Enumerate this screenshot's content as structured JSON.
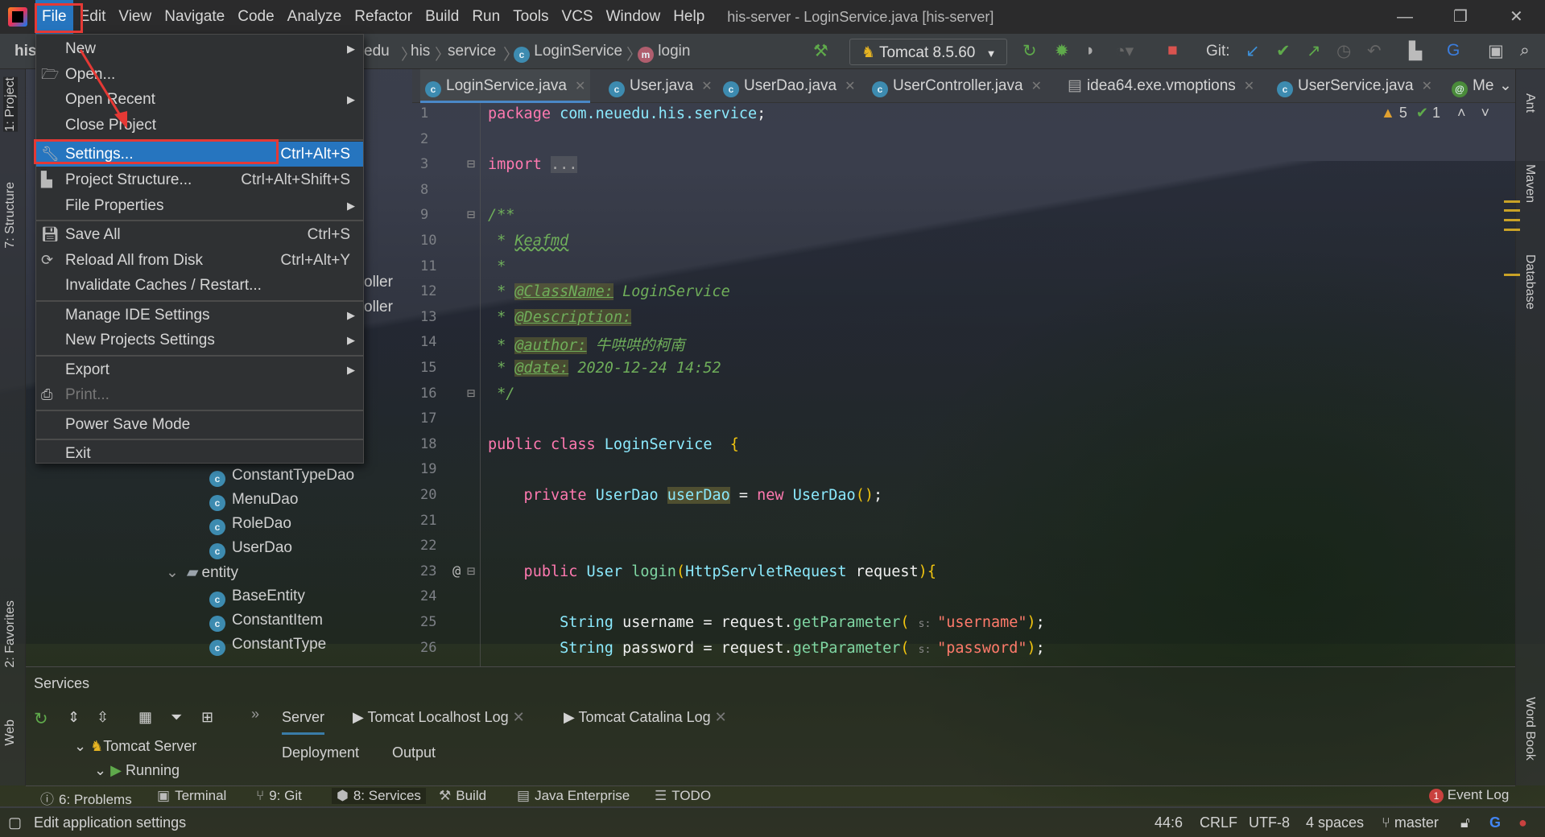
{
  "window": {
    "title": "his-server - LoginService.java [his-server]",
    "minimize": "—",
    "restore": "❐",
    "close": "✕"
  },
  "menubar": [
    "File",
    "Edit",
    "View",
    "Navigate",
    "Code",
    "Analyze",
    "Refactor",
    "Build",
    "Run",
    "Tools",
    "VCS",
    "Window",
    "Help"
  ],
  "breadcrumb": {
    "project": "his",
    "items": [
      "edu",
      "his",
      "service"
    ],
    "class": "LoginService",
    "method": "login"
  },
  "toolbar": {
    "run_config": "Tomcat 8.5.60",
    "git_label": "Git:",
    "accent": "#2675bf"
  },
  "tabs": [
    {
      "label": "LoginService.java",
      "icon": "c",
      "selected": true
    },
    {
      "label": "User.java",
      "icon": "c"
    },
    {
      "label": "UserDao.java",
      "icon": "c"
    },
    {
      "label": "UserController.java",
      "icon": "c"
    },
    {
      "label": "idea64.exe.vmoptions",
      "icon": "file"
    },
    {
      "label": "UserService.java",
      "icon": "c"
    },
    {
      "label": "Me",
      "icon": "@"
    }
  ],
  "left_strip": {
    "project": "1: Project",
    "structure": "7: Structure",
    "favorites": "2: Favorites",
    "web": "Web"
  },
  "right_strip": {
    "ant": "Ant",
    "maven": "Maven",
    "database": "Database",
    "wordbook": "Word Book"
  },
  "file_menu": [
    {
      "label": "New",
      "submenu": true
    },
    {
      "label": "Open...",
      "icon": "folder-icon"
    },
    {
      "label": "Open Recent",
      "submenu": true
    },
    {
      "label": "Close Project"
    },
    {
      "label": "Settings...",
      "shortcut": "Ctrl+Alt+S",
      "icon": "wrench-icon",
      "highlighted": true
    },
    {
      "label": "Project Structure...",
      "shortcut": "Ctrl+Alt+Shift+S",
      "icon": "project-structure-icon"
    },
    {
      "label": "File Properties",
      "submenu": true
    },
    {
      "label": "Save All",
      "shortcut": "Ctrl+S",
      "icon": "save-icon"
    },
    {
      "label": "Reload All from Disk",
      "shortcut": "Ctrl+Alt+Y",
      "icon": "reload-icon"
    },
    {
      "label": "Invalidate Caches / Restart..."
    },
    {
      "label": "Manage IDE Settings",
      "submenu": true
    },
    {
      "label": "New Projects Settings",
      "submenu": true
    },
    {
      "label": "Export",
      "submenu": true
    },
    {
      "label": "Print...",
      "icon": "print-icon",
      "disabled": true
    },
    {
      "label": "Power Save Mode"
    },
    {
      "label": "Exit"
    }
  ],
  "project_tree": {
    "partial": [
      "oller",
      "oller"
    ],
    "items": [
      {
        "label": "ConstantTypeDao",
        "type": "class"
      },
      {
        "label": "MenuDao",
        "type": "class"
      },
      {
        "label": "RoleDao",
        "type": "class"
      },
      {
        "label": "UserDao",
        "type": "class"
      },
      {
        "label": "entity",
        "type": "folder"
      },
      {
        "label": "BaseEntity",
        "type": "class"
      },
      {
        "label": "ConstantItem",
        "type": "class"
      },
      {
        "label": "ConstantType",
        "type": "class"
      }
    ]
  },
  "inspections": {
    "warnings": "5",
    "ok": "1"
  },
  "code": [
    {
      "n": "1",
      "t": [
        [
          "k",
          "package "
        ],
        [
          "t",
          "com.neuedu.his.service"
        ],
        [
          "",
          ";"
        ]
      ]
    },
    {
      "n": "2",
      "t": []
    },
    {
      "n": "3",
      "t": [
        [
          "k",
          "import "
        ],
        [
          "fold",
          "..."
        ]
      ]
    },
    {
      "n": "8",
      "t": []
    },
    {
      "n": "9",
      "t": [
        [
          "c",
          "/**"
        ]
      ]
    },
    {
      "n": "10",
      "t": [
        [
          "c",
          " * "
        ],
        [
          "cw",
          "Keafmd"
        ]
      ]
    },
    {
      "n": "11",
      "t": [
        [
          "c",
          " *"
        ]
      ]
    },
    {
      "n": "12",
      "t": [
        [
          "c",
          " * "
        ],
        [
          "ct",
          "@ClassName:"
        ],
        [
          "c",
          " LoginService"
        ]
      ]
    },
    {
      "n": "13",
      "t": [
        [
          "c",
          " * "
        ],
        [
          "ct",
          "@Description:"
        ]
      ]
    },
    {
      "n": "14",
      "t": [
        [
          "c",
          " * "
        ],
        [
          "ct",
          "@author:"
        ],
        [
          "c",
          " 牛哄哄的柯南"
        ]
      ]
    },
    {
      "n": "15",
      "t": [
        [
          "c",
          " * "
        ],
        [
          "ct",
          "@date:"
        ],
        [
          "c",
          " 2020-12-24 14:52"
        ]
      ]
    },
    {
      "n": "16",
      "t": [
        [
          "c",
          " */"
        ]
      ]
    },
    {
      "n": "17",
      "t": []
    },
    {
      "n": "18",
      "t": [
        [
          "k",
          "public class "
        ],
        [
          "t",
          "LoginService"
        ],
        [
          "",
          " "
        ],
        [
          "p",
          " {"
        ]
      ]
    },
    {
      "n": "19",
      "t": []
    },
    {
      "n": "20",
      "t": [
        [
          "k",
          "    private "
        ],
        [
          "t",
          "UserDao "
        ],
        [
          "h",
          "userDao"
        ],
        [
          "",
          " = "
        ],
        [
          "k",
          "new "
        ],
        [
          "t",
          "UserDao"
        ],
        [
          "p",
          "()"
        ],
        [
          "",
          ";"
        ]
      ]
    },
    {
      "n": "21",
      "t": []
    },
    {
      "n": "22",
      "t": []
    },
    {
      "n": "23",
      "t": [
        [
          "k",
          "    public "
        ],
        [
          "t",
          "User "
        ],
        [
          "f",
          "login"
        ],
        [
          "p",
          "("
        ],
        [
          "t",
          "HttpServletRequest "
        ],
        [
          "",
          "request"
        ],
        [
          "p",
          ")"
        ],
        [
          "p",
          "{"
        ]
      ]
    },
    {
      "n": "24",
      "t": []
    },
    {
      "n": "25",
      "t": [
        [
          "t",
          "        String "
        ],
        [
          "",
          "username = request."
        ],
        [
          "f",
          "getParameter"
        ],
        [
          "p",
          "( "
        ],
        [
          "g",
          "s: "
        ],
        [
          "s",
          "\"username\""
        ],
        [
          "p",
          ")"
        ],
        [
          "",
          ";"
        ]
      ]
    },
    {
      "n": "26",
      "t": [
        [
          "t",
          "        String "
        ],
        [
          "",
          "password = request."
        ],
        [
          "f",
          "getParameter"
        ],
        [
          "p",
          "( "
        ],
        [
          "g",
          "s: "
        ],
        [
          "s",
          "\"password\""
        ],
        [
          "p",
          ")"
        ],
        [
          "",
          ";"
        ]
      ]
    }
  ],
  "services": {
    "title": "Services",
    "tabs": [
      "Server",
      "Tomcat Localhost Log",
      "Tomcat Catalina Log"
    ],
    "subtabs": [
      "Deployment",
      "Output"
    ],
    "tree": [
      "Tomcat Server",
      "Running"
    ]
  },
  "tool_windows": [
    "6: Problems",
    "Terminal",
    "9: Git",
    "8: Services",
    "Build",
    "Java Enterprise",
    "TODO"
  ],
  "event_log": {
    "label": "Event Log",
    "count": "1"
  },
  "status": {
    "message": "Edit application settings",
    "position": "44:6",
    "line_sep": "CRLF",
    "encoding": "UTF-8",
    "indent": "4 spaces",
    "branch": "master"
  }
}
